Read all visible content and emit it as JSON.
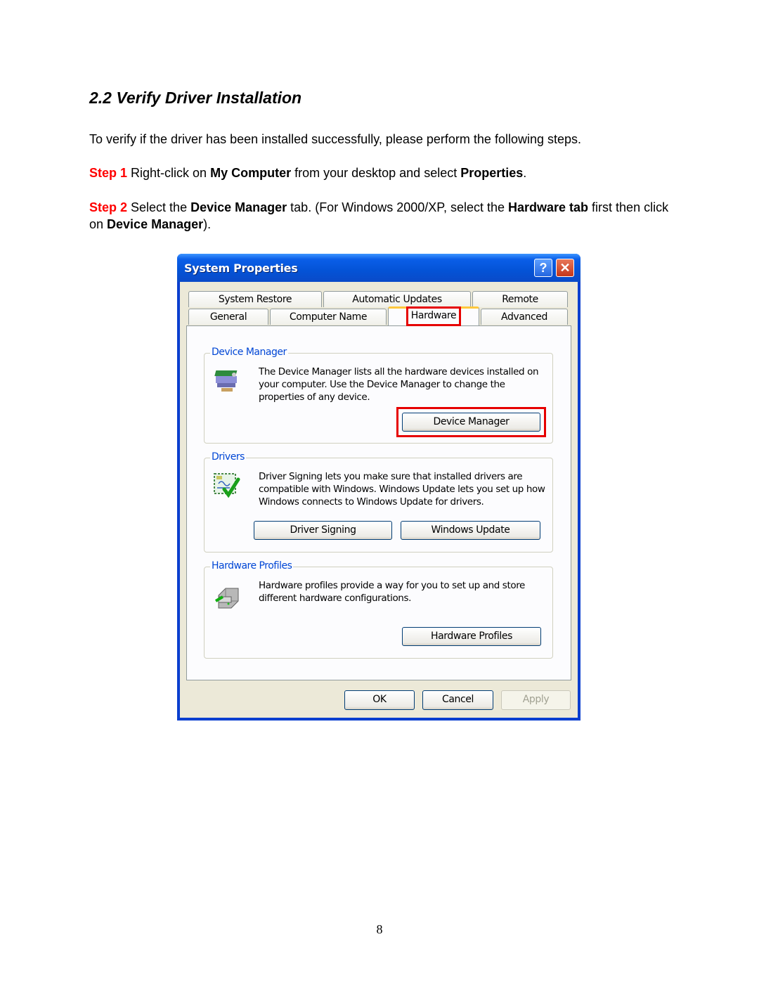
{
  "document": {
    "heading": "2.2 Verify Driver Installation",
    "intro": "To verify if the driver has been installed successfully, please perform the following steps.",
    "step1": {
      "label": "Step 1",
      "text_a": " Right-click on ",
      "bold_a": "My Computer",
      "text_b": " from your desktop and select ",
      "bold_b": "Properties",
      "text_c": "."
    },
    "step2": {
      "label": "Step 2",
      "text_a": " Select the ",
      "bold_a": "Device Manager",
      "text_b": " tab. (For Windows 2000/XP, select the ",
      "bold_b": "Hardware tab",
      "text_c": " first then click on ",
      "bold_c": "Device Manager",
      "text_d": ")."
    },
    "page_number": "8",
    "step_color": "#ff0000"
  },
  "dialog": {
    "title": "System Properties",
    "help_glyph": "?",
    "close_glyph": "✕",
    "tabs_row1": [
      "System Restore",
      "Automatic Updates",
      "Remote"
    ],
    "tabs_row2": [
      "General",
      "Computer Name",
      "Hardware",
      "Advanced"
    ],
    "active_tab": "Hardware",
    "groups": {
      "device_manager": {
        "label": "Device Manager",
        "text": "The Device Manager lists all the hardware devices installed on your computer. Use the Device Manager to change the properties of any device.",
        "button": "Device Manager"
      },
      "drivers": {
        "label": "Drivers",
        "text": "Driver Signing lets you make sure that installed drivers are compatible with Windows. Windows Update lets you set up how Windows connects to Windows Update for drivers.",
        "button_signing": "Driver Signing",
        "button_update": "Windows Update"
      },
      "hardware_profiles": {
        "label": "Hardware Profiles",
        "text": "Hardware profiles provide a way for you to set up and store different hardware configurations.",
        "button": "Hardware Profiles"
      }
    },
    "footer": {
      "ok": "OK",
      "cancel": "Cancel",
      "apply": "Apply"
    },
    "highlight_color": "#e60000"
  }
}
